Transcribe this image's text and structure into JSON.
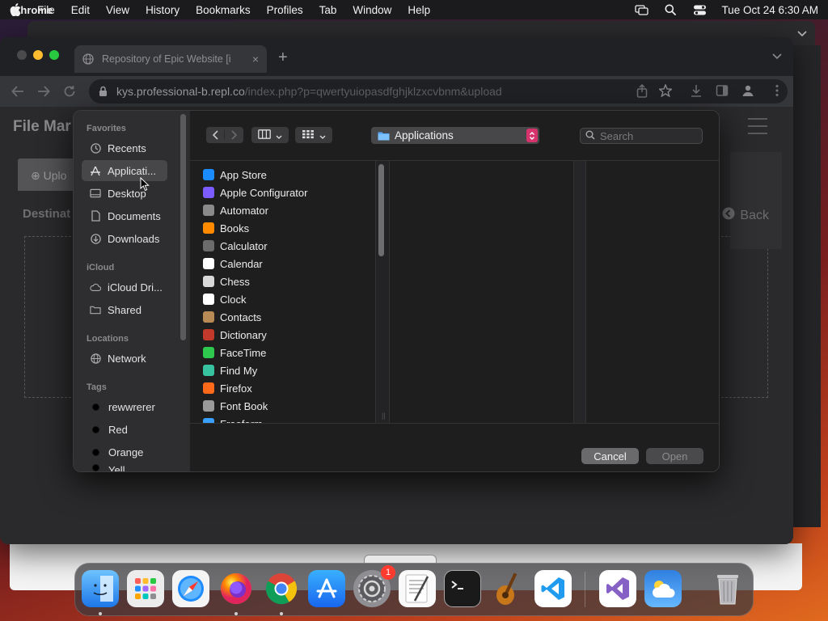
{
  "menubar": {
    "app_name": "Chrome",
    "items": [
      "File",
      "Edit",
      "View",
      "History",
      "Bookmarks",
      "Profiles",
      "Tab",
      "Window",
      "Help"
    ],
    "clock": "Tue Oct 24  6:30 AM"
  },
  "browser": {
    "tab_title": "Repository of Epic Website [i",
    "url_host": "kys.professional-b.repl.co",
    "url_path": "/index.php?p=qwertyuiopasdfghjklzxcvbnm&upload"
  },
  "page": {
    "title": "File Mar",
    "upload_tab": "Uplo",
    "destination_label": "Destinat",
    "back_label": "Back"
  },
  "dialog": {
    "sidebar": {
      "favorites_header": "Favorites",
      "favorites": [
        {
          "label": "Recents",
          "icon": "clock-icon"
        },
        {
          "label": "Applicati...",
          "icon": "applications-icon",
          "selected": true
        },
        {
          "label": "Desktop",
          "icon": "desktop-icon"
        },
        {
          "label": "Documents",
          "icon": "document-icon"
        },
        {
          "label": "Downloads",
          "icon": "download-icon"
        }
      ],
      "icloud_header": "iCloud",
      "icloud": [
        {
          "label": "iCloud Dri...",
          "icon": "cloud-icon"
        },
        {
          "label": "Shared",
          "icon": "shared-folder-icon"
        }
      ],
      "locations_header": "Locations",
      "locations": [
        {
          "label": "Network",
          "icon": "globe-icon"
        }
      ],
      "tags_header": "Tags",
      "tags": [
        "rewwrerer",
        "Red",
        "Orange",
        "Yell"
      ]
    },
    "location": "Applications",
    "search_placeholder": "Search",
    "apps": [
      {
        "name": "App Store",
        "color": "#1a8cff"
      },
      {
        "name": "Apple Configurator",
        "color": "#7c5cff"
      },
      {
        "name": "Automator",
        "color": "#8a8a8a"
      },
      {
        "name": "Books",
        "color": "#ff8a00"
      },
      {
        "name": "Calculator",
        "color": "#6b6b6b"
      },
      {
        "name": "Calendar",
        "color": "#ffffff"
      },
      {
        "name": "Chess",
        "color": "#d8d8d8"
      },
      {
        "name": "Clock",
        "color": "#ffffff"
      },
      {
        "name": "Contacts",
        "color": "#b88a55"
      },
      {
        "name": "Dictionary",
        "color": "#c0392b"
      },
      {
        "name": "FaceTime",
        "color": "#2fc84f"
      },
      {
        "name": "Find My",
        "color": "#37c2a0"
      },
      {
        "name": "Firefox",
        "color": "#ff6a1a"
      },
      {
        "name": "Font Book",
        "color": "#9a9a9a"
      },
      {
        "name": "Freeform",
        "color": "#3aa0ff"
      }
    ],
    "cancel_label": "Cancel",
    "open_label": "Open"
  },
  "dock": {
    "apps": [
      {
        "name": "finder-icon",
        "running": true
      },
      {
        "name": "launchpad-icon",
        "running": false
      },
      {
        "name": "safari-icon",
        "running": false
      },
      {
        "name": "firefox-icon",
        "running": true
      },
      {
        "name": "chrome-icon",
        "running": true
      },
      {
        "name": "app-store-icon",
        "running": false
      },
      {
        "name": "system-settings-icon",
        "running": false,
        "badge": "1"
      },
      {
        "name": "textedit-icon",
        "running": false
      },
      {
        "name": "terminal-icon",
        "running": false
      },
      {
        "name": "garageband-icon",
        "running": false
      },
      {
        "name": "vscode-icon",
        "running": false
      },
      {
        "name": "visual-studio-icon",
        "running": false
      },
      {
        "name": "weather-icon",
        "running": false
      },
      {
        "name": "trash-icon",
        "running": false
      }
    ]
  },
  "colors": {
    "accent_pink": "#d6336c",
    "folder_blue": "#5aa8ff"
  }
}
